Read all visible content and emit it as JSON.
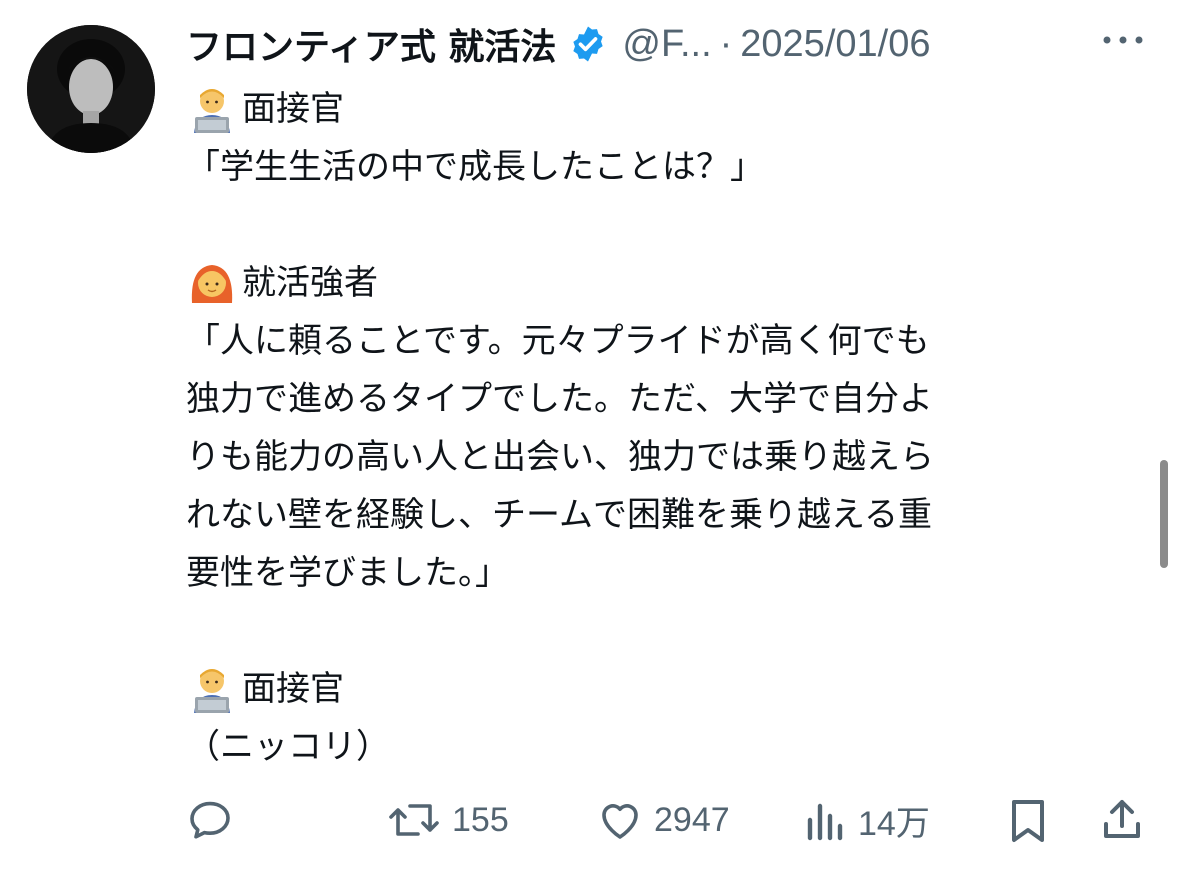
{
  "author": {
    "display_name": "フロンティア式 就活法",
    "handle": "@F...",
    "separator": "·",
    "date": "2025/01/06"
  },
  "tweet": {
    "lines": [
      {
        "emoji": "man-technologist-emoji",
        "text": "面接官"
      },
      {
        "text": "「学生生活の中で成長したことは？」"
      },
      {
        "text": ""
      },
      {
        "emoji": "woman-red-hair-emoji",
        "text": "就活強者"
      },
      {
        "text": "「人に頼ることです。元々プライドが高く何でも"
      },
      {
        "text": "独力で進めるタイプでした。ただ、大学で自分よ"
      },
      {
        "text": "りも能力の高い人と出会い、独力では乗り越えら"
      },
      {
        "text": "れない壁を経験し、チームで困難を乗り越える重"
      },
      {
        "text": "要性を学びました。」"
      },
      {
        "text": ""
      },
      {
        "emoji": "man-technologist-emoji",
        "text": "面接官"
      },
      {
        "text": "（ニッコリ）"
      }
    ]
  },
  "actions": {
    "reply": {
      "icon": "reply-icon",
      "count": ""
    },
    "retweet": {
      "icon": "retweet-icon",
      "count": "155"
    },
    "like": {
      "icon": "heart-icon",
      "count": "2947"
    },
    "views": {
      "icon": "analytics-icon",
      "count": "14万"
    },
    "bookmark": {
      "icon": "bookmark-icon"
    },
    "share": {
      "icon": "share-icon"
    }
  },
  "colors": {
    "text": "#0f1419",
    "muted": "#536471",
    "verified": "#1d9bf0"
  }
}
